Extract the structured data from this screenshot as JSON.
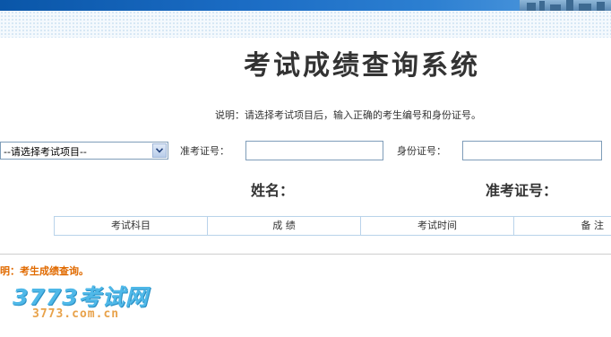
{
  "page": {
    "title": "考试成绩查询系统",
    "note": "说明：请选择考试项目后，输入正确的考生编号和身份证号。"
  },
  "form": {
    "exam_select_value": "--请选择考试项目--",
    "ticket_label": "准考证号：",
    "ticket_value": "",
    "id_label": "身份证号：",
    "id_value": ""
  },
  "result": {
    "name_label": "姓名：",
    "ticket_label": "准考证号："
  },
  "table": {
    "headers": [
      "考试科目",
      "成 绩",
      "考试时间",
      "备 注"
    ]
  },
  "footer": {
    "note": "明：考生成绩查询。",
    "logo_text": "3773考试网",
    "logo_url": "3773.com.cn"
  },
  "colors": {
    "header_blue": "#0a56a8",
    "footnote_orange": "#e06a00",
    "logo_blue": "#4fb8e8",
    "logo_orange": "#e8a24a"
  }
}
